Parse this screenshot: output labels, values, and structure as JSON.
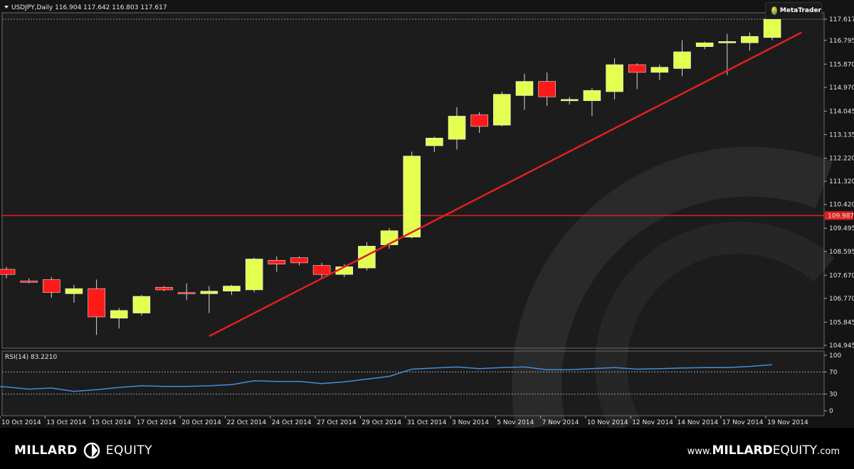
{
  "header": {
    "symbol_info": "USDJPY,Daily  116.904 117.642 116.803 117.617",
    "platform_badge": "MetaTrader"
  },
  "rsi_panel": {
    "label": "RSI(14) 83.2210"
  },
  "colors": {
    "background": "#000000",
    "plot_bg": "#1c1c1c",
    "bull": "#e4ff50",
    "bear": "#ff1a1a",
    "trendline": "#e02020",
    "level": "#e02020",
    "rsi_line": "#3f8fd8",
    "axis_text": "#e6e6e6"
  },
  "chart_data": [
    {
      "type": "candlestick",
      "title": "USDJPY,Daily",
      "ohlc_header": {
        "open": 116.904,
        "high": 117.642,
        "low": 116.803,
        "close": 117.617
      },
      "x_tick_labels": [
        "10 Oct 2014",
        "13 Oct 2014",
        "15 Oct 2014",
        "17 Oct 2014",
        "20 Oct 2014",
        "22 Oct 2014",
        "24 Oct 2014",
        "27 Oct 2014",
        "29 Oct 2014",
        "31 Oct 2014",
        "3 Nov 2014",
        "5 Nov 2014",
        "7 Nov 2014",
        "10 Nov 2014",
        "12 Nov 2014",
        "14 Nov 2014",
        "17 Nov 2014",
        "19 Nov 2014"
      ],
      "y_tick_labels": [
        "117.617",
        "116.795",
        "115.870",
        "114.970",
        "114.045",
        "113.135",
        "112.220",
        "111.320",
        "110.420",
        "109.495",
        "108.595",
        "107.670",
        "106.770",
        "105.845",
        "104.945"
      ],
      "ylim": [
        104.945,
        117.617
      ],
      "horizontal_level": {
        "value": 109.987,
        "label": "109.987"
      },
      "trendline": {
        "from": {
          "index": 9,
          "value": 105.3
        },
        "to": {
          "index": 35.3,
          "value": 117.1
        }
      },
      "candles": [
        {
          "open": 107.9,
          "high": 108.0,
          "low": 107.55,
          "close": 107.7
        },
        {
          "open": 107.45,
          "high": 107.55,
          "low": 107.35,
          "close": 107.4
        },
        {
          "open": 107.5,
          "high": 107.6,
          "low": 106.8,
          "close": 107.0
        },
        {
          "open": 106.95,
          "high": 107.3,
          "low": 106.6,
          "close": 107.15
        },
        {
          "open": 107.15,
          "high": 107.5,
          "low": 105.35,
          "close": 106.05
        },
        {
          "open": 106.0,
          "high": 106.4,
          "low": 105.6,
          "close": 106.3
        },
        {
          "open": 106.2,
          "high": 106.9,
          "low": 106.1,
          "close": 106.85
        },
        {
          "open": 107.2,
          "high": 107.25,
          "low": 107.05,
          "close": 107.1
        },
        {
          "open": 107.0,
          "high": 107.35,
          "low": 106.7,
          "close": 106.95
        },
        {
          "open": 106.95,
          "high": 107.25,
          "low": 106.2,
          "close": 107.05
        },
        {
          "open": 107.05,
          "high": 107.3,
          "low": 106.9,
          "close": 107.25
        },
        {
          "open": 107.1,
          "high": 108.35,
          "low": 107.0,
          "close": 108.3
        },
        {
          "open": 108.25,
          "high": 108.4,
          "low": 107.8,
          "close": 108.1
        },
        {
          "open": 108.35,
          "high": 108.4,
          "low": 108.05,
          "close": 108.15
        },
        {
          "open": 108.05,
          "high": 108.15,
          "low": 107.55,
          "close": 107.7
        },
        {
          "open": 107.7,
          "high": 108.1,
          "low": 107.6,
          "close": 108.0
        },
        {
          "open": 107.95,
          "high": 108.95,
          "low": 107.85,
          "close": 108.8
        },
        {
          "open": 108.85,
          "high": 109.5,
          "low": 108.7,
          "close": 109.4
        },
        {
          "open": 109.15,
          "high": 112.47,
          "low": 109.1,
          "close": 112.3
        },
        {
          "open": 112.7,
          "high": 113.05,
          "low": 112.45,
          "close": 113.0
        },
        {
          "open": 112.95,
          "high": 114.2,
          "low": 112.55,
          "close": 113.85
        },
        {
          "open": 113.9,
          "high": 114.0,
          "low": 113.2,
          "close": 113.45
        },
        {
          "open": 113.5,
          "high": 114.8,
          "low": 113.45,
          "close": 114.7
        },
        {
          "open": 114.65,
          "high": 115.5,
          "low": 114.1,
          "close": 115.2
        },
        {
          "open": 115.2,
          "high": 115.55,
          "low": 114.25,
          "close": 114.6
        },
        {
          "open": 114.5,
          "high": 114.6,
          "low": 114.3,
          "close": 114.5
        },
        {
          "open": 114.45,
          "high": 114.95,
          "low": 113.85,
          "close": 114.85
        },
        {
          "open": 114.8,
          "high": 116.1,
          "low": 114.5,
          "close": 115.85
        },
        {
          "open": 115.85,
          "high": 115.9,
          "low": 114.9,
          "close": 115.55
        },
        {
          "open": 115.55,
          "high": 115.85,
          "low": 115.25,
          "close": 115.75
        },
        {
          "open": 115.7,
          "high": 116.8,
          "low": 115.4,
          "close": 116.35
        },
        {
          "open": 116.55,
          "high": 116.75,
          "low": 116.45,
          "close": 116.7
        },
        {
          "open": 116.7,
          "high": 117.05,
          "low": 115.45,
          "close": 116.75
        },
        {
          "open": 116.7,
          "high": 117.1,
          "low": 116.4,
          "close": 116.95
        },
        {
          "open": 116.904,
          "high": 117.642,
          "low": 116.803,
          "close": 117.617
        }
      ]
    },
    {
      "type": "line",
      "title": "RSI(14) 83.2210",
      "ylim": [
        0,
        100
      ],
      "y_tick_labels": [
        "100",
        "70",
        "30",
        "0"
      ],
      "levels": [
        70,
        30
      ],
      "series": [
        {
          "values": [
            44,
            43,
            39,
            41,
            35,
            38,
            42,
            45,
            44,
            44,
            45,
            47,
            54,
            53,
            53,
            49,
            52,
            57,
            62,
            75,
            77,
            79,
            76,
            78,
            79,
            74,
            74,
            76,
            78,
            75,
            76,
            77,
            78,
            78,
            80,
            83
          ]
        }
      ]
    }
  ],
  "footer": {
    "brand_left_strong": "MILLARD",
    "brand_left_light": "EQUITY",
    "url_prefix": "www.",
    "url_strong": "MILLARD",
    "url_light": "EQUITY",
    "url_suffix": ".com"
  }
}
